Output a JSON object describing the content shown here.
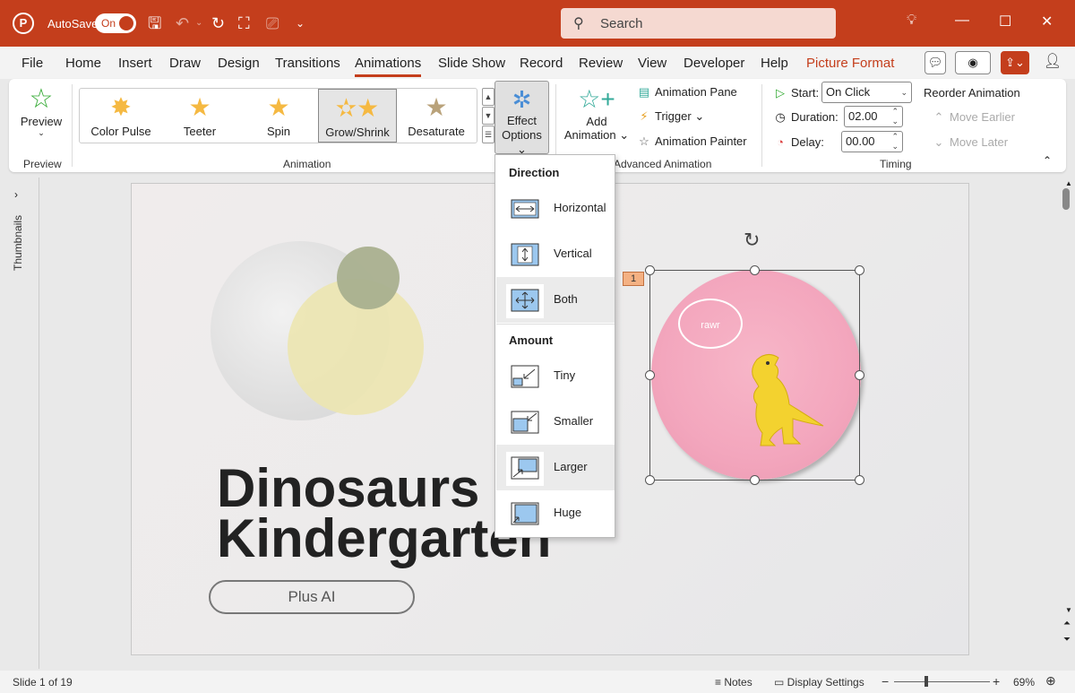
{
  "titlebar": {
    "logo": "P",
    "autosave_label": "AutoSave",
    "autosave_state": "On",
    "search_placeholder": "Search"
  },
  "menu": {
    "tabs": [
      "File",
      "Home",
      "Insert",
      "Draw",
      "Design",
      "Transitions",
      "Animations",
      "Slide Show",
      "Record",
      "Review",
      "View",
      "Developer",
      "Help",
      "Picture Format"
    ],
    "active": "Animations",
    "accent_color": "#c43e1c"
  },
  "ribbon": {
    "preview": {
      "label": "Preview",
      "group": "Preview"
    },
    "animation_group": "Animation",
    "gallery": [
      {
        "label": "Color Pulse"
      },
      {
        "label": "Teeter"
      },
      {
        "label": "Spin"
      },
      {
        "label": "Grow/Shrink",
        "selected": true
      },
      {
        "label": "Desaturate"
      }
    ],
    "effect_options": {
      "line1": "Effect",
      "line2": "Options"
    },
    "add_animation": {
      "line1": "Add",
      "line2": "Animation"
    },
    "animation_pane": "Animation Pane",
    "trigger": "Trigger",
    "animation_painter": "Animation Painter",
    "advanced_group": "Advanced Animation",
    "start_label": "Start:",
    "start_value": "On Click",
    "duration_label": "Duration:",
    "duration_value": "02.00",
    "delay_label": "Delay:",
    "delay_value": "00.00",
    "timing_group": "Timing",
    "reorder_label": "Reorder Animation",
    "move_earlier": "Move Earlier",
    "move_later": "Move Later"
  },
  "thumbnails_label": "Thumbnails",
  "slide": {
    "title_line1": "Dinosaurs f",
    "title_line2": "Kindergarten",
    "button": "Plus AI",
    "bubble_text": "rawr",
    "animation_tag": "1"
  },
  "dropdown": {
    "direction_header": "Direction",
    "direction_items": [
      "Horizontal",
      "Vertical",
      "Both"
    ],
    "amount_header": "Amount",
    "amount_items": [
      "Tiny",
      "Smaller",
      "Larger",
      "Huge"
    ]
  },
  "status": {
    "slide_info": "Slide 1 of 19",
    "notes": "Notes",
    "display_settings": "Display Settings",
    "zoom": "69%"
  }
}
